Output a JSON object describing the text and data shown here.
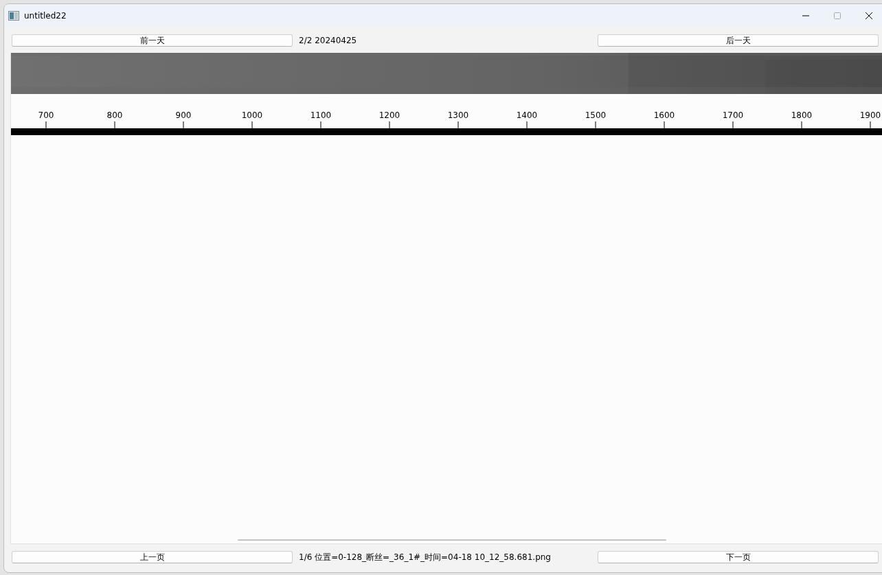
{
  "window": {
    "title": "untitled22"
  },
  "top_bar": {
    "prev_button": "前一天",
    "info": "2/2 20240425",
    "next_button": "后一天"
  },
  "ruler": {
    "ticks": [
      "700",
      "800",
      "900",
      "1000",
      "1100",
      "1200",
      "1300",
      "1400",
      "1500",
      "1600",
      "1700",
      "1800",
      "1900"
    ]
  },
  "bottom_bar": {
    "prev_button": "上一页",
    "info": "1/6 位置=0-128_断丝=_36_1#_时间=04-18 10_12_58.681.png",
    "next_button": "下一页"
  }
}
